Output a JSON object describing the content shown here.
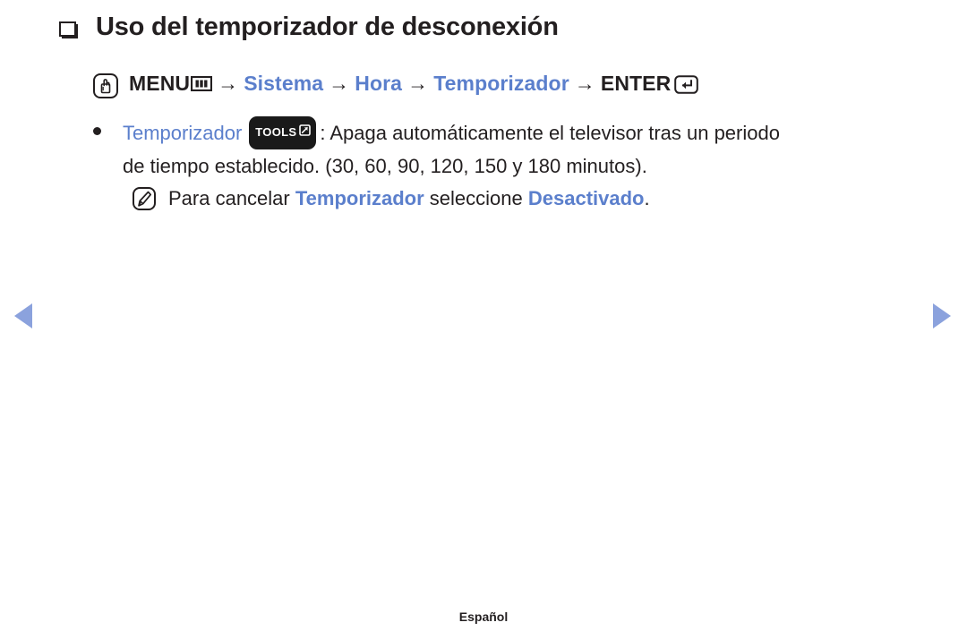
{
  "document": {
    "heading": "Uso del temporizador de desconexión",
    "footer_label": "Español"
  },
  "menu_path": {
    "remote_icon_name": "hand-press-icon",
    "menu_label": "MENU",
    "menu_icon_name": "menu-bars-icon",
    "arrow": "→",
    "steps": [
      {
        "label": "Sistema",
        "color": "#5b7fcc"
      },
      {
        "label": "Hora",
        "color": "#5b7fcc"
      },
      {
        "label": "Temporizador",
        "color": "#5b7fcc"
      }
    ],
    "enter_label": "ENTER",
    "enter_icon_name": "enter-return-icon"
  },
  "bullet": {
    "term": "Temporizador",
    "badge_label": "TOOLS",
    "badge_icon_name": "tools-popup-icon",
    "description_part1": ": Apaga automáticamente el televisor tras un periodo",
    "description_part2": "de tiempo establecido. (30, 60, 90, 120, 150 y 180 minutos)."
  },
  "note": {
    "icon_name": "pencil-note-icon",
    "text_before": "Para cancelar ",
    "term1": "Temporizador",
    "text_middle": " seleccione ",
    "term2": "Desactivado",
    "text_after": "."
  },
  "navigation": {
    "prev_icon_name": "triangle-left-icon",
    "next_icon_name": "triangle-right-icon",
    "arrow_color": "#8ba2dd"
  },
  "colors": {
    "accent_blue": "#5b7fcc",
    "nav_blue": "#8ba2dd",
    "text_black": "#231f20"
  }
}
